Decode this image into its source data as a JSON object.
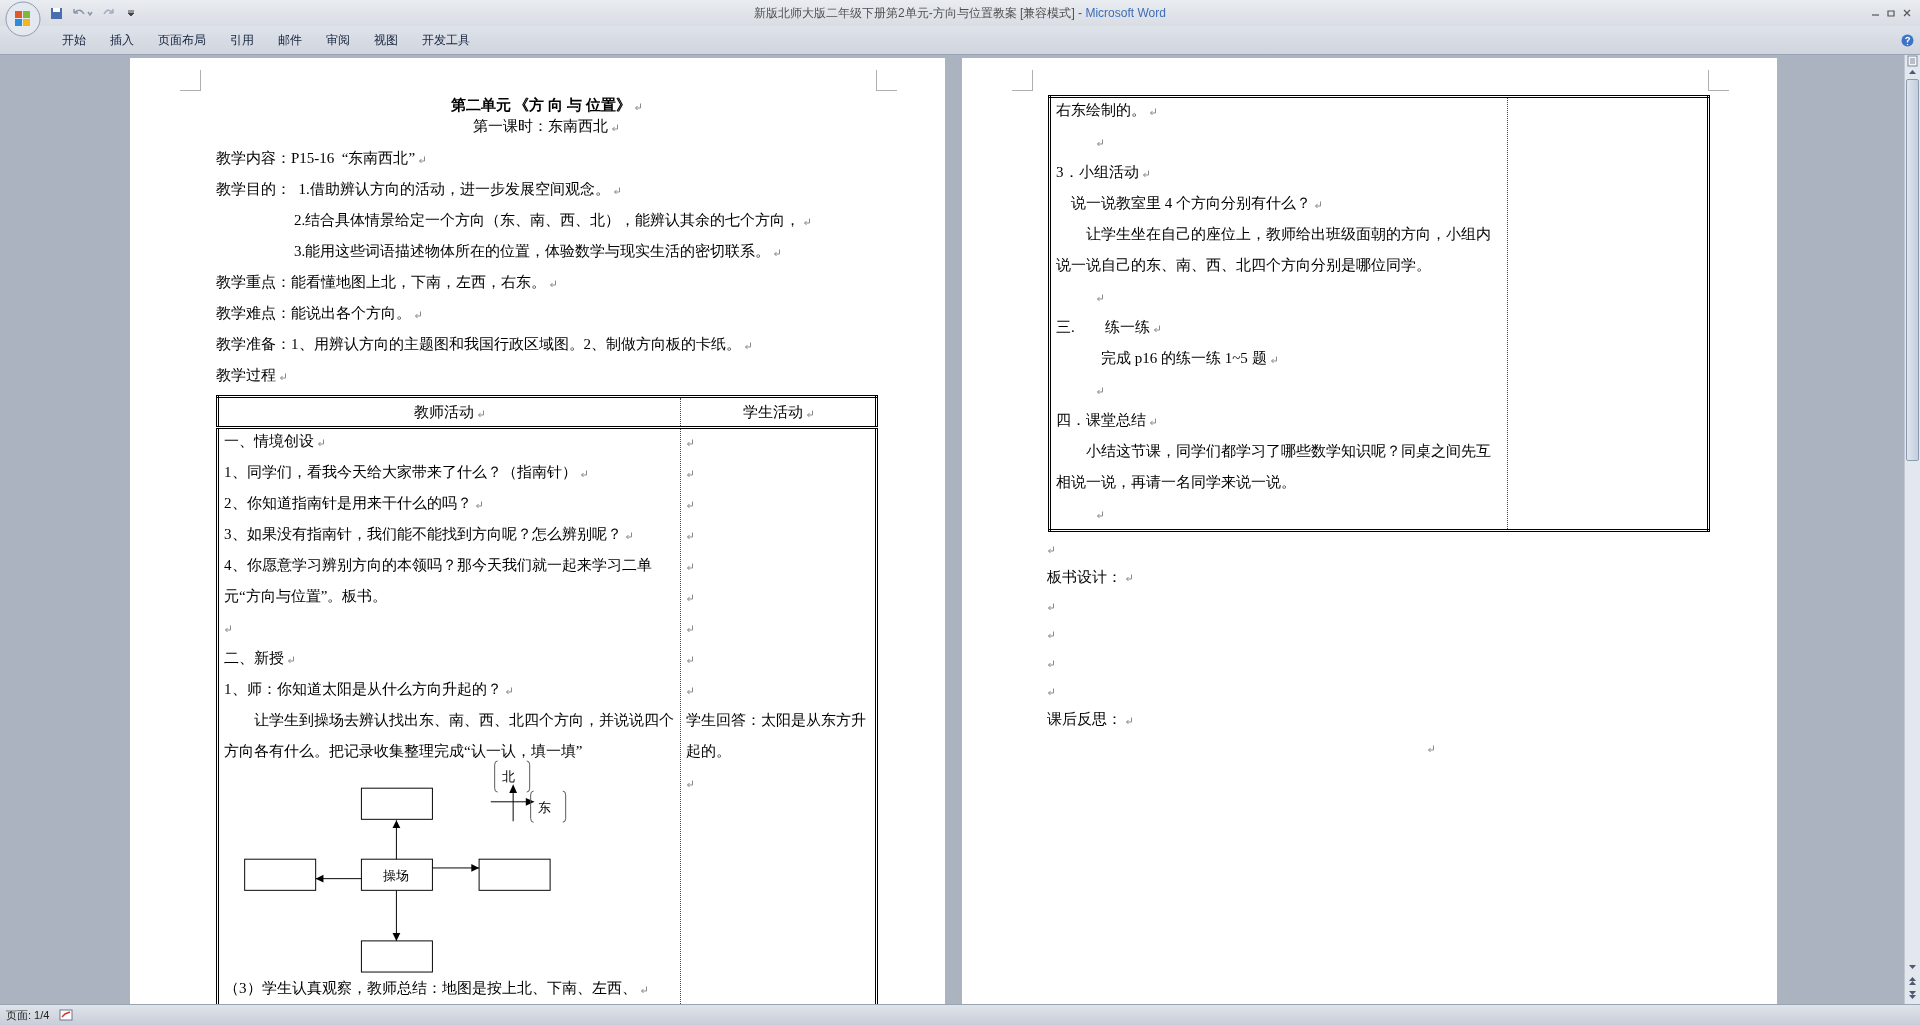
{
  "window": {
    "document_title": "新版北师大版二年级下册第2单元-方向与位置教案 [兼容模式]",
    "separator": "-",
    "app_name": "Microsoft Word"
  },
  "ribbon_tabs": [
    {
      "label": "开始",
      "selected": false
    },
    {
      "label": "插入",
      "selected": false
    },
    {
      "label": "页面布局",
      "selected": false
    },
    {
      "label": "引用",
      "selected": false
    },
    {
      "label": "邮件",
      "selected": false
    },
    {
      "label": "审阅",
      "selected": false
    },
    {
      "label": "视图",
      "selected": false
    },
    {
      "label": "开发工具",
      "selected": false
    }
  ],
  "pages": [
    {
      "heading": "第二单元 《方 向 与 位置》",
      "subheading": "第一课时：东南西北",
      "before_table": [
        {
          "kind": "text",
          "text": "教学内容：P15-16  “东南西北”"
        },
        {
          "kind": "text",
          "text": "教学目的：  1.借助辨认方向的活动，进一步发展空间观念。"
        },
        {
          "kind": "hanging",
          "text": "2.结合具体情景给定一个方向（东、南、西、北），能辨认其余的七个方向，"
        },
        {
          "kind": "hanging",
          "text": "3.能用这些词语描述物体所在的位置，体验数学与现实生活的密切联系。"
        },
        {
          "kind": "text",
          "text": "教学重点：能看懂地图上北，下南，左西，右东。"
        },
        {
          "kind": "text",
          "text": "教学难点：能说出各个方向。"
        },
        {
          "kind": "text",
          "text": "教学准备：1、用辨认方向的主题图和我国行政区域图。2、制做方向板的卡纸。"
        },
        {
          "kind": "text",
          "text": "教学过程"
        }
      ],
      "table": {
        "columns": [
          "教师活动",
          "学生活动"
        ],
        "teacher": [
          {
            "kind": "text",
            "text": "一、情境创设"
          },
          {
            "kind": "text",
            "text": "1、同学们，看我今天给大家带来了什么？（指南针）"
          },
          {
            "kind": "text",
            "text": "2、你知道指南针是用来干什么的吗？"
          },
          {
            "kind": "text",
            "text": "3、如果没有指南针，我们能不能找到方向呢？怎么辨别呢？"
          },
          {
            "kind": "text",
            "text": "4、你愿意学习辨别方向的本领吗？那今天我们就一起来学习二单元“方向与位置”。板书。"
          },
          {
            "kind": "blank"
          },
          {
            "kind": "text",
            "text": "二、新授"
          },
          {
            "kind": "text",
            "text": "1、师：你知道太阳是从什么方向升起的？"
          },
          {
            "kind": "indent",
            "text": "让学生到操场去辨认找出东、南、西、北四个方向，并说说四个方向各有什么。把记录收集整理完成“认一认，填一填”"
          },
          {
            "kind": "diagram",
            "center": "操场",
            "north": "北",
            "east": "东"
          },
          {
            "kind": "text",
            "text": "（3）学生认真观察，教师总结：地图是按上北、下南、左西、"
          }
        ],
        "student": [
          {
            "kind": "blank"
          },
          {
            "kind": "blank"
          },
          {
            "kind": "blank"
          },
          {
            "kind": "blank"
          },
          {
            "kind": "blank"
          },
          {
            "kind": "blank"
          },
          {
            "kind": "blank"
          },
          {
            "kind": "blank"
          },
          {
            "kind": "blank"
          },
          {
            "kind": "text",
            "text": "学生回答：太阳是从东方升起的。"
          },
          {
            "kind": "blank"
          }
        ]
      }
    },
    {
      "table": {
        "teacher": [
          {
            "kind": "text",
            "text": "右东绘制的。"
          },
          {
            "kind": "blank_indented"
          },
          {
            "kind": "text",
            "text": "3．小组活动"
          },
          {
            "kind": "text",
            "text": "　说一说教室里 4 个方向分别有什么？"
          },
          {
            "kind": "indent",
            "text": "让学生坐在自己的座位上，教师给出班级面朝的方向，小组内说一说自己的东、南、西、北四个方向分别是哪位同学。"
          },
          {
            "kind": "blank_indented"
          },
          {
            "kind": "text",
            "text": "三.　　练一练"
          },
          {
            "kind": "indent",
            "text": "　完成 p16 的练一练 1~5 题"
          },
          {
            "kind": "blank_indented"
          },
          {
            "kind": "text",
            "text": "四．课堂总结"
          },
          {
            "kind": "indent",
            "text": "小结这节课，同学们都学习了哪些数学知识呢？同桌之间先互相说一说，再请一名同学来说一说。"
          },
          {
            "kind": "blank_indented"
          }
        ]
      },
      "after_table": [
        {
          "kind": "blank"
        },
        {
          "kind": "text",
          "text": "板书设计："
        },
        {
          "kind": "blank"
        },
        {
          "kind": "blank"
        },
        {
          "kind": "blank"
        },
        {
          "kind": "blank"
        },
        {
          "kind": "text",
          "text": "课后反思："
        },
        {
          "kind": "blank_centered"
        }
      ]
    }
  ],
  "status_bar": {
    "page": "页面: 1/4"
  }
}
